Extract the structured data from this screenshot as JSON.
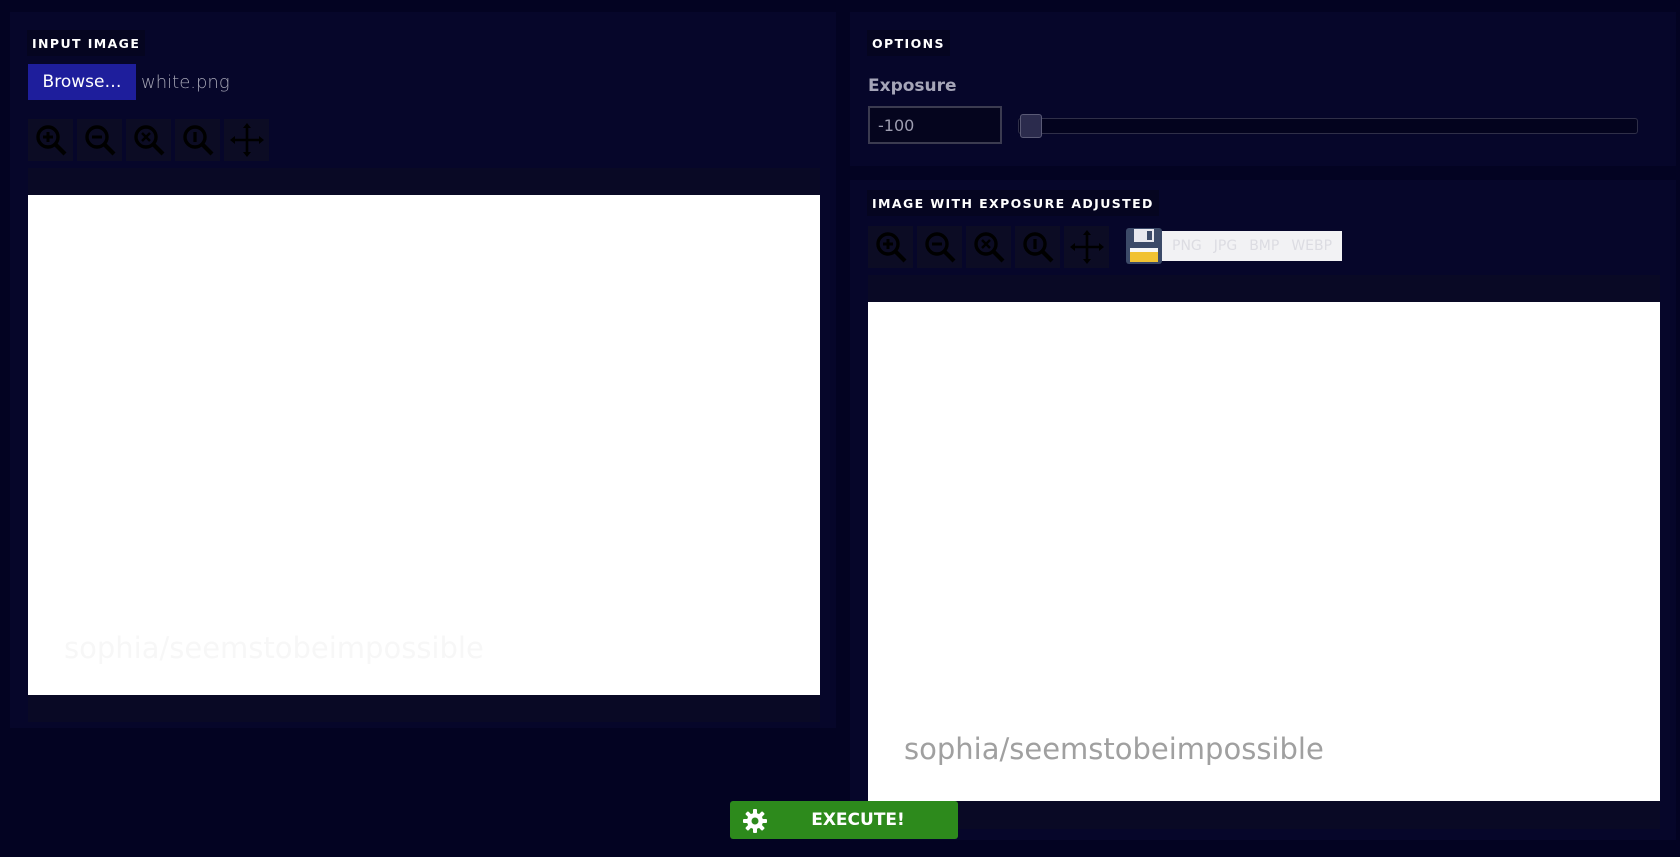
{
  "input_section": {
    "title": "INPUT IMAGE",
    "browse_label": "Browse…",
    "filename": "white.png",
    "tools": [
      "zoom-in-icon",
      "zoom-out-icon",
      "zoom-fit-icon",
      "zoom-reset-icon",
      "pan-icon"
    ],
    "watermark": "sophia/seemstobeimpossible"
  },
  "options_section": {
    "title": "OPTIONS",
    "exposure_label": "Exposure",
    "exposure_value": "-100",
    "exposure_slider_level": 0
  },
  "output_section": {
    "title": "IMAGE WITH EXPOSURE ADJUSTED",
    "tools": [
      "zoom-in-icon",
      "zoom-out-icon",
      "zoom-fit-icon",
      "zoom-reset-icon",
      "pan-icon"
    ],
    "save_icon": "floppy-disk-icon",
    "formats": [
      "PNG",
      "JPG",
      "BMP",
      "WEBP"
    ],
    "watermark": "sophia/seemstobeimpossible"
  },
  "execute": {
    "label": "EXECUTE!",
    "icon": "gear-icon",
    "color": "#2d8a1c"
  },
  "colors": {
    "background": "#030322",
    "browse_button": "#1e1e9c"
  }
}
